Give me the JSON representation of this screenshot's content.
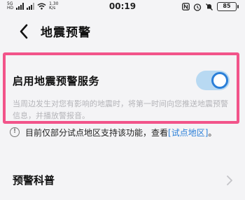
{
  "status_bar": {
    "net1": "5G",
    "net2": "HD",
    "net_speed_value": "1.30",
    "net_speed_unit": "K/s",
    "time": "00:19",
    "battery": "85"
  },
  "header": {
    "title": "地震预警"
  },
  "service": {
    "title": "启用地震预警服务",
    "description": "当周边发生对您有影响的地震时，将第一时间向您推送地震预警信息，并播放警报音。",
    "enabled": true
  },
  "notice": {
    "text": "目前仅部分试点地区支持该功能，查看",
    "link": "[试点地区]",
    "end": "。"
  },
  "popular_science": {
    "label": "预警科普"
  },
  "colors": {
    "accent": "#2b7fd8",
    "highlight_border": "#f2548a",
    "background": "#f4f4f6"
  }
}
